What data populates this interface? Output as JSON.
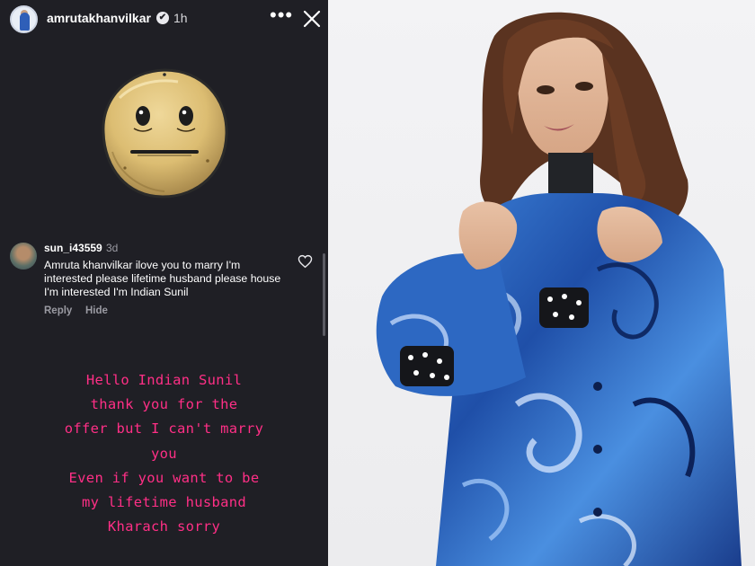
{
  "story": {
    "username": "amrutakhanvilkar",
    "verified_mark": "✔",
    "time": "1h",
    "more_label": "•••",
    "icons": [
      "avatar",
      "verified-icon",
      "more-icon",
      "close-icon",
      "sticker-face",
      "heart-icon"
    ],
    "comment": {
      "user": "sun_i43559",
      "time": "3d",
      "text": "Amruta khanvilkar ilove you to marry I'm interested please lifetime husband please house I'm interested I'm Indian Sunil",
      "reply_label": "Reply",
      "hide_label": "Hide"
    },
    "reply_lines": [
      "Hello Indian  Sunil",
      "thank you for the",
      "offer but I can't marry",
      "you",
      "Even if you want to be",
      "my lifetime husband",
      "Kharach sorry"
    ]
  },
  "colors": {
    "story_bg": "#1f1f25",
    "reply_text": "#ff2f86",
    "secondary_text": "#9a9aa2",
    "photo_bg": "#f0f0f2",
    "jacket_blue": "#2f6fc9"
  }
}
